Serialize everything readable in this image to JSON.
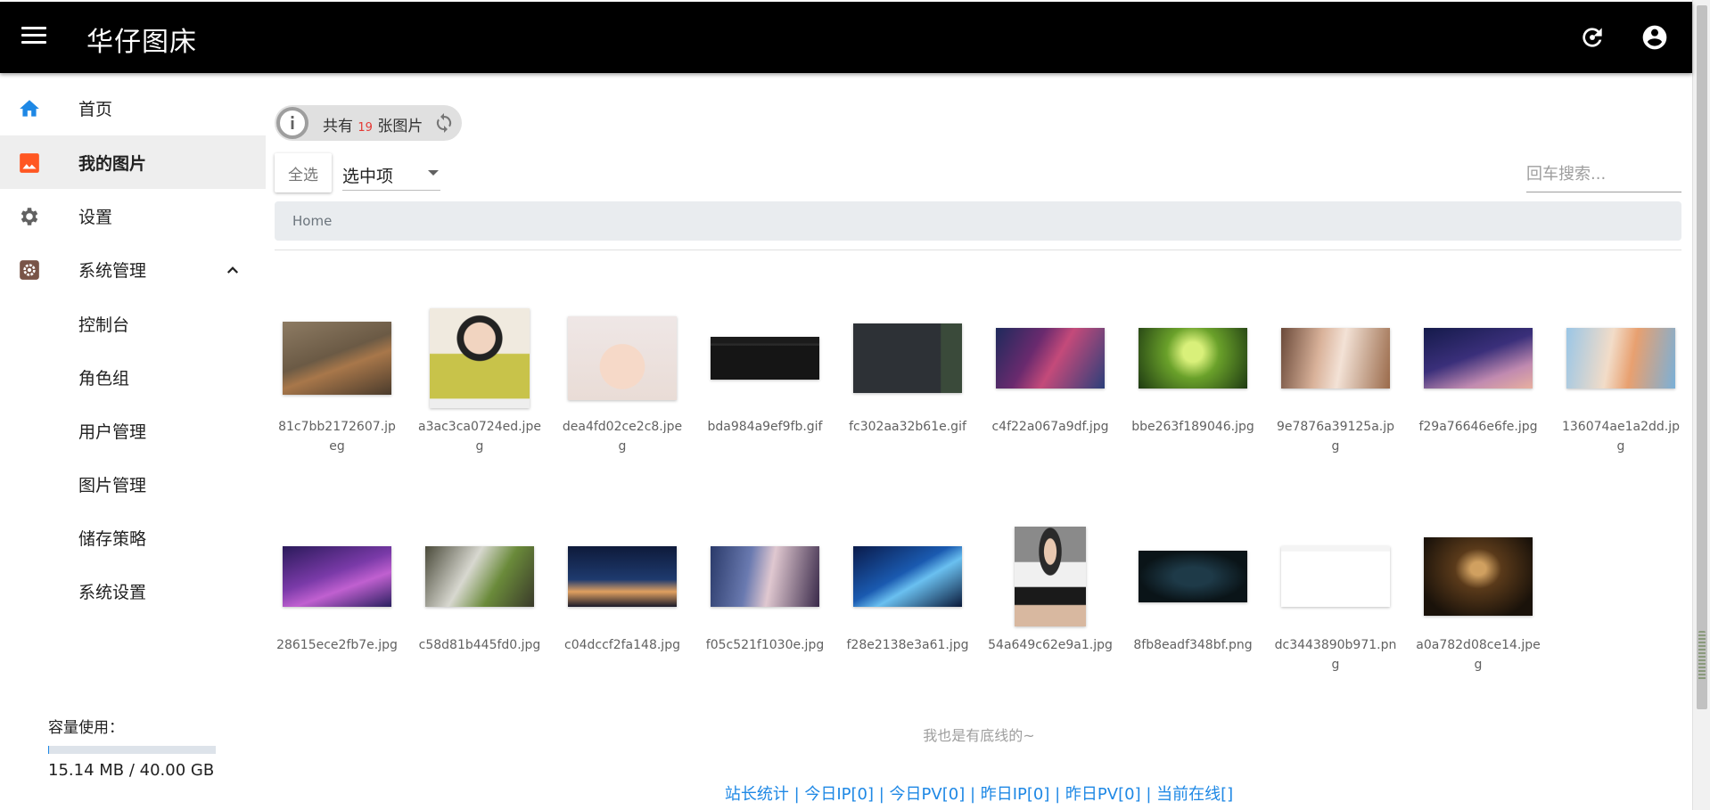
{
  "app": {
    "title": "华仔图床"
  },
  "appbar": {
    "menu_icon": "menu-icon",
    "refresh_icon": "refresh-icon",
    "account_icon": "account-circle-icon"
  },
  "sidebar": {
    "items": [
      {
        "label": "首页",
        "icon": "home-icon",
        "color": "#1e88e5"
      },
      {
        "label": "我的图片",
        "icon": "image-icon",
        "color": "#ff5722"
      },
      {
        "label": "设置",
        "icon": "gear-icon",
        "color": "#616161"
      },
      {
        "label": "系统管理",
        "icon": "admin-gear-icon",
        "color": "#795548"
      }
    ],
    "subitems": [
      {
        "label": "控制台"
      },
      {
        "label": "角色组"
      },
      {
        "label": "用户管理"
      },
      {
        "label": "图片管理"
      },
      {
        "label": "储存策略"
      },
      {
        "label": "系统设置"
      }
    ],
    "storage": {
      "label": "容量使用：",
      "value": "15.14 MB / 40.00 GB",
      "used_fraction": 0.0004
    }
  },
  "toolbar": {
    "count_prefix": "共有",
    "count": "19",
    "count_suffix": "张图片",
    "select_all": "全选",
    "selected_option": "选中项",
    "search_placeholder": "回车搜索..."
  },
  "breadcrumb": {
    "home": "Home"
  },
  "images": [
    {
      "name": "81c7bb2172607.jpeg"
    },
    {
      "name": "a3ac3ca0724ed.jpeg"
    },
    {
      "name": "dea4fd02ce2c8.jpeg"
    },
    {
      "name": "bda984a9ef9fb.gif"
    },
    {
      "name": "fc302aa32b61e.gif"
    },
    {
      "name": "c4f22a067a9df.jpg"
    },
    {
      "name": "bbe263f189046.jpg"
    },
    {
      "name": "9e7876a39125a.jpg"
    },
    {
      "name": "f29a76646e6fe.jpg"
    },
    {
      "name": "136074ae1a2dd.jpg"
    },
    {
      "name": "28615ece2fb7e.jpg"
    },
    {
      "name": "c58d81b445fd0.jpg"
    },
    {
      "name": "c04dccf2fa148.jpg"
    },
    {
      "name": "f05c521f1030e.jpg"
    },
    {
      "name": "f28e2138e3a61.jpg"
    },
    {
      "name": "54a649c62e9a1.jpg"
    },
    {
      "name": "8fb8eadf348bf.png"
    },
    {
      "name": "dc3443890b971.png"
    },
    {
      "name": "a0a782d08ce14.jpeg"
    }
  ],
  "footer": {
    "note": "我也是有底线的~",
    "stats": [
      "站长统计",
      "今日IP[0]",
      "今日PV[0]",
      "昨日IP[0]",
      "昨日PV[0]",
      "当前在线[]"
    ],
    "separator": " | "
  }
}
